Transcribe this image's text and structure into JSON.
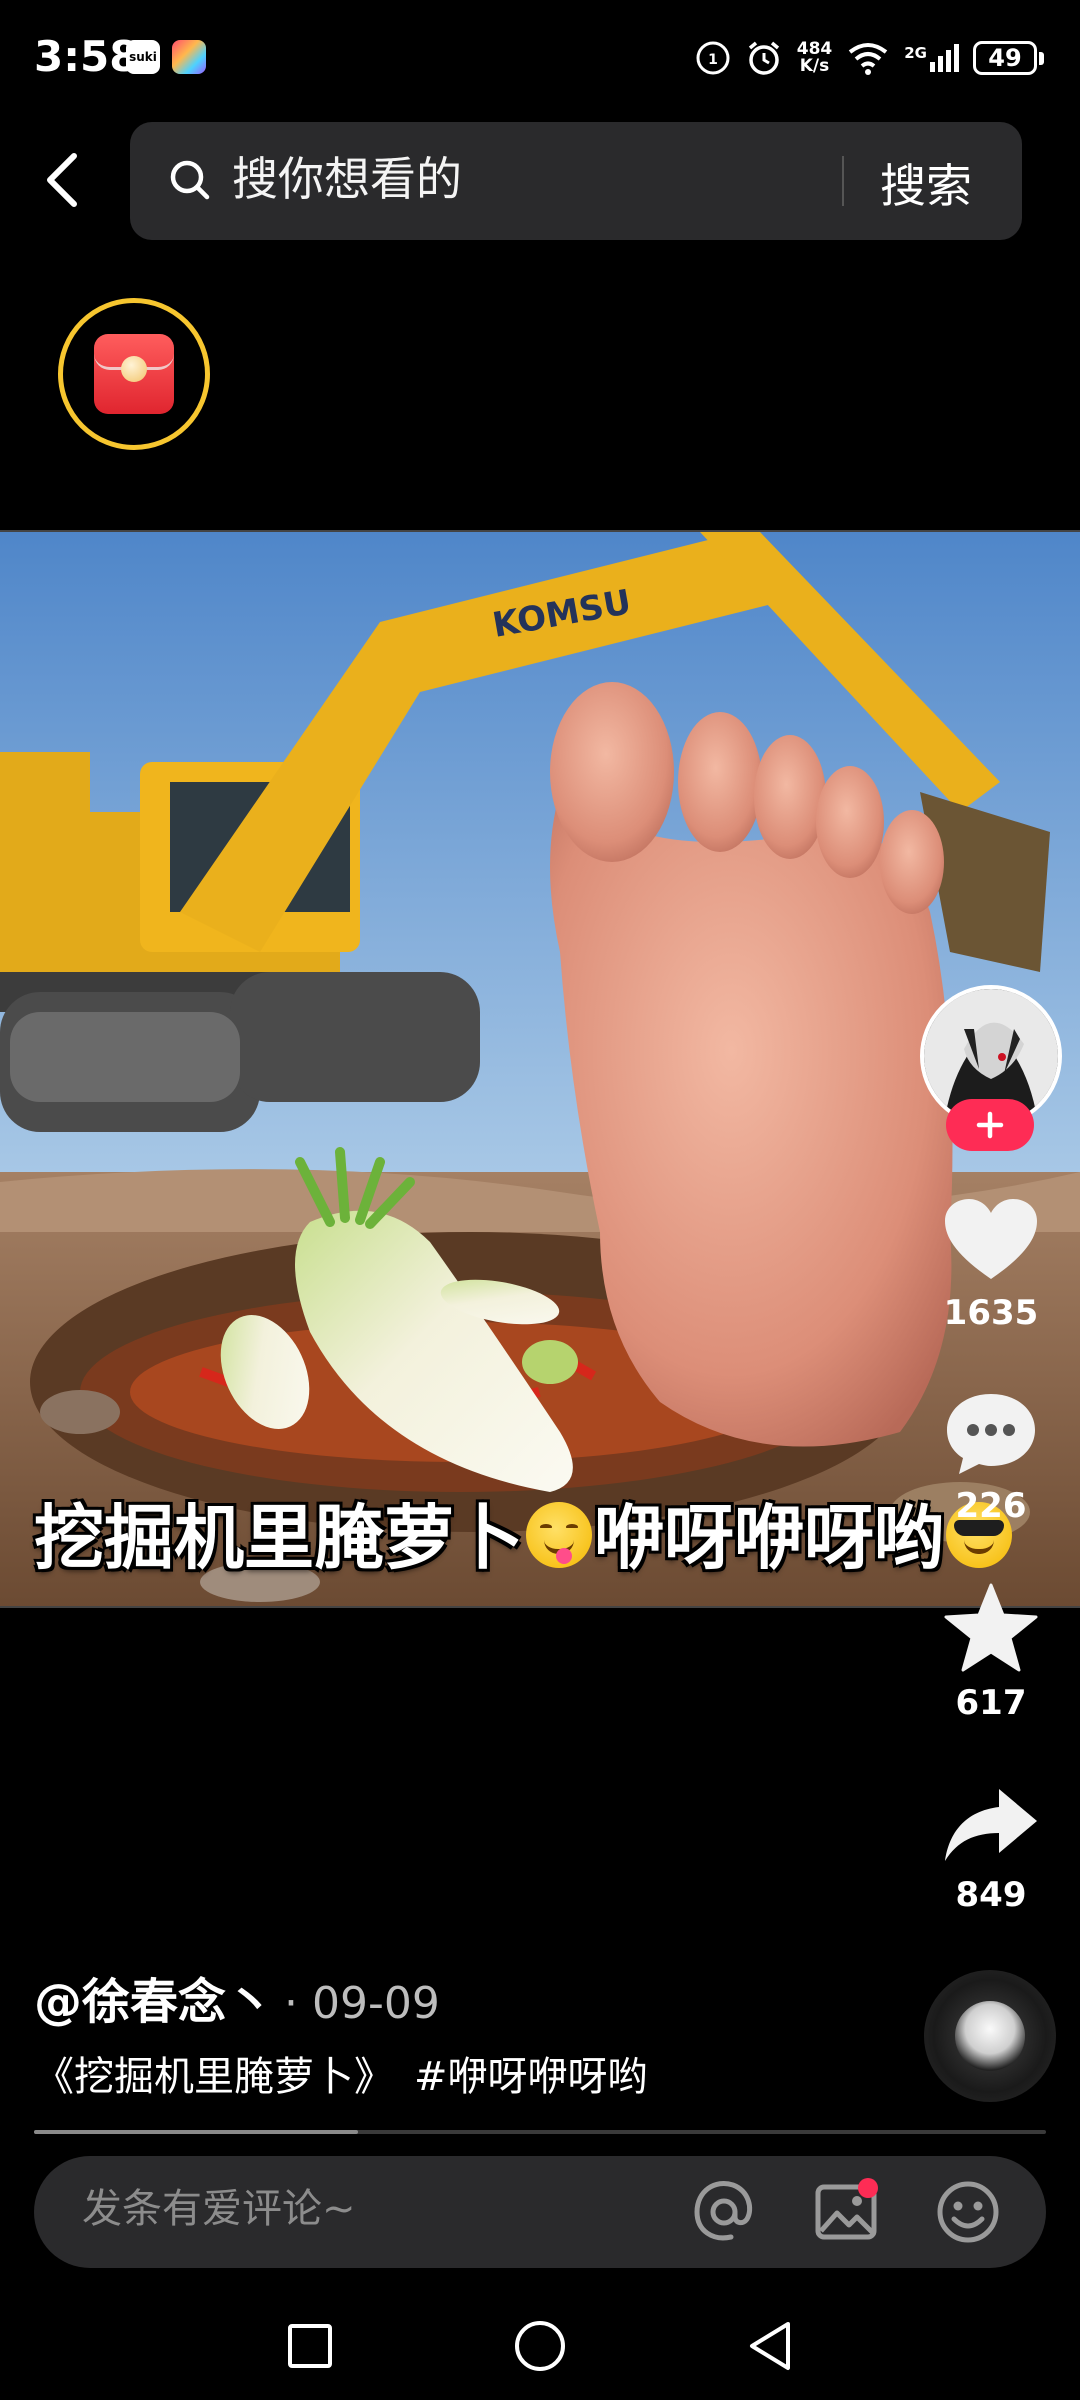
{
  "status_bar": {
    "time": "3:58",
    "app_icon_label": "suki",
    "net_speed_value": "484",
    "net_speed_unit": "K/s",
    "network_type": "2G",
    "battery": "49"
  },
  "header": {
    "search_placeholder": "搜你想看的",
    "search_button": "搜索"
  },
  "video": {
    "caption_part1": "挖掘机里腌萝卜",
    "caption_part2": "咿呀咿呀哟",
    "excavator_brand": "KOMSU"
  },
  "actions": {
    "likes": "1635",
    "comments": "226",
    "favorites": "617",
    "shares": "849"
  },
  "post": {
    "author": "@徐春念丶",
    "date": "· 09-09",
    "title": "《挖掘机里腌萝卜》",
    "hashtag": "#咿呀咿呀哟",
    "progress_fraction": 0.32
  },
  "comment": {
    "placeholder": "发条有爱评论~"
  },
  "icons": {
    "back": "chevron-left-icon",
    "search": "search-icon",
    "like": "heart-icon",
    "comment": "comment-bubble-icon",
    "favorite": "star-icon",
    "share": "share-arrow-icon",
    "mention": "at-icon",
    "image": "image-icon",
    "emoji": "emoji-icon"
  },
  "colors": {
    "accent": "#fe2c55",
    "ring": "#f7c62f",
    "background": "#000000"
  }
}
